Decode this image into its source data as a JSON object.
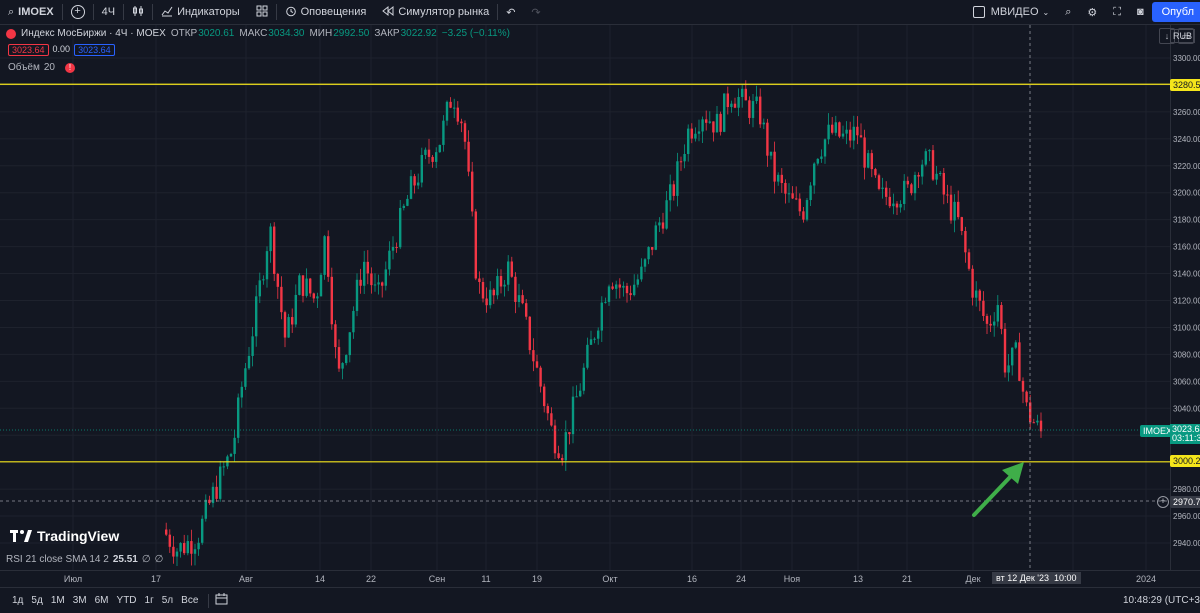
{
  "toolbar": {
    "symbol": "IMOEX",
    "interval": "4Ч",
    "indicators_label": "Индикаторы",
    "alerts_label": "Оповещения",
    "replay_label": "Симулятор рынка",
    "compare_symbol": "МВИДЕО",
    "publish_label": "Опубл"
  },
  "legend": {
    "title": "Индекс МосБиржи · 4Ч · MOEX",
    "open_label": "ОТКР",
    "open": "3020.61",
    "high_label": "МАКС",
    "high": "3034.30",
    "low_label": "МИН",
    "low": "2992.50",
    "close_label": "ЗАКР",
    "close": "3022.92",
    "change": "−3.25 (−0.11%)",
    "bid": "3023.64",
    "spread": "0.00",
    "ask": "3023.64",
    "currency": "RUB"
  },
  "volume": {
    "label": "Объём",
    "length": "20"
  },
  "rsi": {
    "label": "RSI 21 close SMA 14 2",
    "value": "25.51",
    "extra1": "∅",
    "extra2": "∅"
  },
  "logo_text": "TradingView",
  "colors": {
    "up": "#089981",
    "down": "#f23645",
    "level": "#f5e61b",
    "arrow": "#3fae49",
    "bg": "#131722"
  },
  "price_labels": {
    "level_high": "3280.52",
    "level_low": "3000.27",
    "current_symbol": "IMOEX",
    "current_price": "3023.64",
    "countdown": "03:11:31",
    "crosshair": "2970.75"
  },
  "time_axis": {
    "crosshair_label": "вт 12 Дек '23",
    "crosshair_time": "10:00"
  },
  "bottom": {
    "ranges": [
      "1д",
      "5д",
      "1М",
      "3М",
      "6М",
      "YTD",
      "1г",
      "5л",
      "Все"
    ],
    "clock": "10:48:29 (UTC+3"
  },
  "chart_data": {
    "type": "candlestick",
    "ylim": [
      2930,
      3310
    ],
    "yticks": [
      2940,
      2960,
      2980,
      3000,
      3020,
      3040,
      3060,
      3080,
      3100,
      3120,
      3140,
      3160,
      3180,
      3200,
      3220,
      3240,
      3260,
      3280,
      3300
    ],
    "xticks": [
      {
        "label": "Июл",
        "x": 73
      },
      {
        "label": "17",
        "x": 156
      },
      {
        "label": "Авг",
        "x": 246
      },
      {
        "label": "14",
        "x": 320
      },
      {
        "label": "22",
        "x": 371
      },
      {
        "label": "Сен",
        "x": 437
      },
      {
        "label": "11",
        "x": 486
      },
      {
        "label": "19",
        "x": 537
      },
      {
        "label": "Окт",
        "x": 610
      },
      {
        "label": "16",
        "x": 692
      },
      {
        "label": "24",
        "x": 741
      },
      {
        "label": "Ноя",
        "x": 792
      },
      {
        "label": "13",
        "x": 858
      },
      {
        "label": "21",
        "x": 907
      },
      {
        "label": "Дек",
        "x": 973
      },
      {
        "label": "19",
        "x": 1073
      },
      {
        "label": "2024",
        "x": 1146
      }
    ],
    "horizontal_levels": [
      3280.52,
      3000.27
    ],
    "anchors": [
      {
        "x": 165,
        "p": 2950
      },
      {
        "x": 180,
        "p": 2935
      },
      {
        "x": 200,
        "p": 2945
      },
      {
        "x": 215,
        "p": 2975
      },
      {
        "x": 235,
        "p": 3010
      },
      {
        "x": 245,
        "p": 3060
      },
      {
        "x": 258,
        "p": 3110
      },
      {
        "x": 272,
        "p": 3175
      },
      {
        "x": 288,
        "p": 3090
      },
      {
        "x": 303,
        "p": 3135
      },
      {
        "x": 318,
        "p": 3120
      },
      {
        "x": 328,
        "p": 3170
      },
      {
        "x": 340,
        "p": 3060
      },
      {
        "x": 352,
        "p": 3100
      },
      {
        "x": 366,
        "p": 3150
      },
      {
        "x": 380,
        "p": 3120
      },
      {
        "x": 395,
        "p": 3160
      },
      {
        "x": 412,
        "p": 3200
      },
      {
        "x": 428,
        "p": 3225
      },
      {
        "x": 443,
        "p": 3240
      },
      {
        "x": 455,
        "p": 3275
      },
      {
        "x": 466,
        "p": 3250
      },
      {
        "x": 480,
        "p": 3130
      },
      {
        "x": 495,
        "p": 3120
      },
      {
        "x": 510,
        "p": 3145
      },
      {
        "x": 525,
        "p": 3110
      },
      {
        "x": 542,
        "p": 3060
      },
      {
        "x": 555,
        "p": 3020
      },
      {
        "x": 565,
        "p": 3010
      },
      {
        "x": 580,
        "p": 3050
      },
      {
        "x": 598,
        "p": 3100
      },
      {
        "x": 612,
        "p": 3140
      },
      {
        "x": 628,
        "p": 3125
      },
      {
        "x": 645,
        "p": 3140
      },
      {
        "x": 660,
        "p": 3175
      },
      {
        "x": 675,
        "p": 3200
      },
      {
        "x": 690,
        "p": 3245
      },
      {
        "x": 705,
        "p": 3260
      },
      {
        "x": 720,
        "p": 3250
      },
      {
        "x": 733,
        "p": 3275
      },
      {
        "x": 748,
        "p": 3265
      },
      {
        "x": 762,
        "p": 3260
      },
      {
        "x": 775,
        "p": 3215
      },
      {
        "x": 790,
        "p": 3195
      },
      {
        "x": 805,
        "p": 3185
      },
      {
        "x": 818,
        "p": 3230
      },
      {
        "x": 833,
        "p": 3245
      },
      {
        "x": 848,
        "p": 3240
      },
      {
        "x": 860,
        "p": 3245
      },
      {
        "x": 870,
        "p": 3220
      },
      {
        "x": 882,
        "p": 3195
      },
      {
        "x": 895,
        "p": 3200
      },
      {
        "x": 910,
        "p": 3200
      },
      {
        "x": 922,
        "p": 3225
      },
      {
        "x": 935,
        "p": 3220
      },
      {
        "x": 948,
        "p": 3195
      },
      {
        "x": 960,
        "p": 3180
      },
      {
        "x": 975,
        "p": 3130
      },
      {
        "x": 990,
        "p": 3100
      },
      {
        "x": 1000,
        "p": 3120
      },
      {
        "x": 1008,
        "p": 3070
      },
      {
        "x": 1020,
        "p": 3080
      },
      {
        "x": 1028,
        "p": 3040
      },
      {
        "x": 1036,
        "p": 3030
      },
      {
        "x": 1042,
        "p": 3022
      }
    ],
    "candle_spacing": 3.6,
    "x_start": 165,
    "x_end": 1042
  }
}
